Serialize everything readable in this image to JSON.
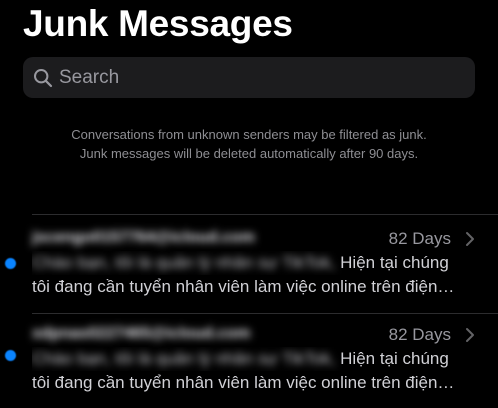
{
  "header": {
    "title": "Junk Messages"
  },
  "search": {
    "placeholder": "Search"
  },
  "info": {
    "line1": "Conversations from unknown senders may be filtered as junk.",
    "line2": "Junk messages will be deleted automatically after 90 days."
  },
  "messages": [
    {
      "sender": "jscengo0157764@icloud.com",
      "date": "82 Days",
      "preview_hidden": "Chào bạn, tôi là quản lý nhân sự TikTok,",
      "preview_visible": "Hiện tại chúng",
      "preview_line2": "tôi đang cần tuyển nhân viên làm việc online trên điện…",
      "unread": true
    },
    {
      "sender": "xdpnas0227465@icloud.com",
      "date": "82 Days",
      "preview_hidden": "Chào bạn, tôi là quản lý nhân sự TikTok,",
      "preview_visible": "Hiện tại chúng",
      "preview_line2": "tôi đang cần tuyển nhân viên làm việc online trên điện…",
      "unread": true
    }
  ],
  "colors": {
    "background": "#000000",
    "search_bg": "#1c1c1e",
    "secondary_text": "#8e8e93",
    "unread_dot": "#0a84ff"
  },
  "icons": {
    "search": "magnifying-glass",
    "chevron": "chevron-right"
  }
}
